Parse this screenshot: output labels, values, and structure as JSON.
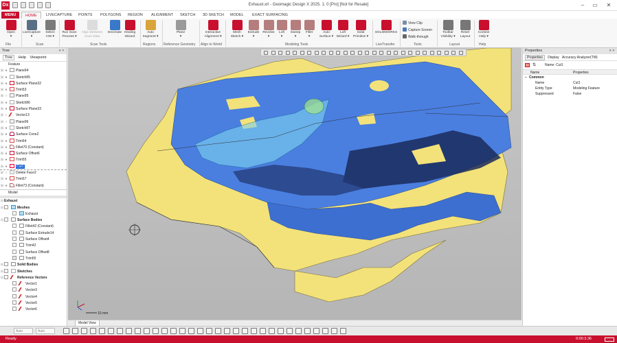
{
  "window": {
    "title": "Exhaust.xrl - Geomagic Design X 2025. 1. 0 [Pro] [Not for Resale]",
    "app_logo": "Dx",
    "controls": [
      "–",
      "▭",
      "✕"
    ]
  },
  "tabs": [
    "MENU",
    "HOME",
    "LIVECAPTURE",
    "POINTS",
    "POLYGONS",
    "REGION",
    "ALIGNMENT",
    "SKETCH",
    "3D SKETCH",
    "MODEL",
    "EXACT SURFACING"
  ],
  "ribbon": {
    "buttons": [
      {
        "label": "Open",
        "sub": "▾",
        "icon": "open-icon",
        "color": "#c8102e"
      },
      {
        "label": "LiveCapture",
        "sub": "▾",
        "icon": "livecapture-icon",
        "color": "#5a6f86"
      },
      {
        "label": "Select",
        "sub": "HW ▾",
        "icon": "select-hw-icon",
        "color": "#7a7a7a"
      },
      {
        "label": "Run Scan",
        "sub": "Process ▾",
        "icon": "run-scan-icon",
        "color": "#c8102e"
      },
      {
        "label": "Align Between",
        "sub": "Scan Data",
        "icon": "align-scan-icon",
        "color": "#bbbbbb",
        "disabled": true
      },
      {
        "label": "Decimate",
        "sub": "",
        "icon": "decimate-icon",
        "color": "#3a78c9"
      },
      {
        "label": "Healing",
        "sub": "Wizard",
        "icon": "healing-icon",
        "color": "#c8102e"
      },
      {
        "label": "Auto",
        "sub": "Segment ▾",
        "icon": "auto-segment-icon",
        "color": "#d9a43a"
      },
      {
        "label": "Plane",
        "sub": "▾",
        "icon": "plane-icon",
        "color": "#9a9a9a"
      },
      {
        "label": "Interactive",
        "sub": "Alignment ▾",
        "icon": "interactive-alignment-icon",
        "color": "#c8102e"
      },
      {
        "label": "Mesh",
        "sub": "Sketch ▾",
        "icon": "mesh-sketch-icon",
        "color": "#c8102e"
      },
      {
        "label": "Extrude",
        "sub": "▾",
        "icon": "extrude-icon",
        "color": "#b57d7d"
      },
      {
        "label": "Revolve",
        "sub": "▾",
        "icon": "revolve-icon",
        "color": "#b57d7d"
      },
      {
        "label": "Loft",
        "sub": "▾",
        "icon": "loft-icon",
        "color": "#b57d7d"
      },
      {
        "label": "Sweep",
        "sub": "▾",
        "icon": "sweep-icon",
        "color": "#b57d7d"
      },
      {
        "label": "Fillet",
        "sub": "▾",
        "icon": "fillet-icon",
        "color": "#b57d7d"
      },
      {
        "label": "Auto",
        "sub": "Surface ▾",
        "icon": "auto-surface-icon",
        "color": "#c8102e"
      },
      {
        "label": "Loft",
        "sub": "Wizard ▾",
        "icon": "loft-wizard-icon",
        "color": "#c8102e"
      },
      {
        "label": "Solid",
        "sub": "Primitive ▾",
        "icon": "solid-primitive-icon",
        "color": "#c8102e"
      },
      {
        "label": "SOLIDWORKS",
        "sub": "",
        "icon": "solidworks-icon",
        "color": "#c8102e"
      },
      {
        "label": "Toolbar",
        "sub": "Visibility ▾",
        "icon": "toolbar-visibility-icon",
        "color": "#777777"
      },
      {
        "label": "Reset",
        "sub": "Layout",
        "icon": "reset-layout-icon",
        "color": "#777777"
      },
      {
        "label": "Context",
        "sub": "Help ▾",
        "icon": "context-help-icon",
        "color": "#c8102e"
      }
    ],
    "small_buttons": [
      {
        "label": "View Clip",
        "color": "#7a8ea8"
      },
      {
        "label": "Capture Screen",
        "color": "#4a78b9"
      },
      {
        "label": "Walk-through",
        "color": "#666666"
      }
    ],
    "groups": [
      "File",
      "Scan",
      "Scan Tools",
      "Regions",
      "Reference Geometry",
      "Align to World",
      "Modeling Tools",
      "LiveTransfer",
      "Tools",
      "Layout",
      "Help"
    ]
  },
  "tree": {
    "title": "Tree",
    "tabs": [
      "Tree",
      "Help",
      "Viewpoint"
    ],
    "header": "Feature",
    "items": [
      {
        "label": "Plane94",
        "icon": "plane",
        "vis": "+"
      },
      {
        "label": "Sketch85",
        "icon": "sketch",
        "vis": "+"
      },
      {
        "label": "Surface Plane32",
        "icon": "surf",
        "vis": "+"
      },
      {
        "label": "Trim53",
        "icon": "trim",
        "vis": "+"
      },
      {
        "label": "Plane95",
        "icon": "plane",
        "vis": ""
      },
      {
        "label": "Sketch86",
        "icon": "sketch",
        "vis": "+"
      },
      {
        "label": "Surface Plane33",
        "icon": "surf",
        "vis": "+"
      },
      {
        "label": "Vector13",
        "icon": "vec",
        "vis": ""
      },
      {
        "label": "Plane96",
        "icon": "plane",
        "vis": ""
      },
      {
        "label": "Sketch87",
        "icon": "sketch",
        "vis": "+"
      },
      {
        "label": "Surface Cone2",
        "icon": "cone",
        "vis": "+"
      },
      {
        "label": "Trim54",
        "icon": "trim",
        "vis": "+"
      },
      {
        "label": "Fillet70 (Constant)",
        "icon": "fillet",
        "vis": "+"
      },
      {
        "label": "Surface Offset6",
        "icon": "surf",
        "vis": "+"
      },
      {
        "label": "Trim55",
        "icon": "trim",
        "vis": "+"
      },
      {
        "label": "Cut1",
        "icon": "cut",
        "vis": "+",
        "selected": true
      },
      {
        "label": "Delete Face2",
        "icon": "del",
        "vis": ""
      },
      {
        "label": "Trim57",
        "icon": "trim",
        "vis": "+"
      },
      {
        "label": "Fillet73 (Constant)",
        "icon": "fillet",
        "vis": "+"
      }
    ],
    "section_label": "Model"
  },
  "model_tree": {
    "root": "Exhaust",
    "items": [
      {
        "label": "Meshes",
        "bold": true,
        "indent": 1,
        "icon": "mesh"
      },
      {
        "label": "Exhaust",
        "indent": 2,
        "icon": "mesh"
      },
      {
        "label": "Surface Bodies",
        "bold": true,
        "indent": 1,
        "icon": "body"
      },
      {
        "label": "Fillet42 (Constant)",
        "indent": 2,
        "icon": "body"
      },
      {
        "label": "Surface Extrude14",
        "indent": 2,
        "icon": "body"
      },
      {
        "label": "Surface Offset4",
        "indent": 2,
        "icon": "body"
      },
      {
        "label": "Trim42",
        "indent": 2,
        "icon": "body"
      },
      {
        "label": "Surface Offset8",
        "indent": 2,
        "icon": "body"
      },
      {
        "label": "Trim55",
        "indent": 2,
        "icon": "body",
        "checked": true
      },
      {
        "label": "Solid Bodies",
        "bold": true,
        "indent": 1,
        "icon": "body"
      },
      {
        "label": "Sketches",
        "bold": true,
        "indent": 1,
        "icon": "sketch"
      },
      {
        "label": "Reference Vectors",
        "bold": true,
        "indent": 1,
        "icon": "vec"
      },
      {
        "label": "Vector1",
        "indent": 2,
        "icon": "vec"
      },
      {
        "label": "Vector3",
        "indent": 2,
        "icon": "vec"
      },
      {
        "label": "Vector4",
        "indent": 2,
        "icon": "vec"
      },
      {
        "label": "Vector5",
        "indent": 2,
        "icon": "vec"
      },
      {
        "label": "Vector6",
        "indent": 2,
        "icon": "vec"
      }
    ]
  },
  "viewport": {
    "scale_label": "10 mm",
    "tab": "Model View",
    "colors": {
      "yellow": "#f3e27a",
      "blue": "#4a7fe0",
      "cyan": "#7fd3ef",
      "bg": "#bdbdbd"
    }
  },
  "properties": {
    "title": "Properties",
    "tabs": [
      "Properties",
      "Display",
      "Accuracy Analyzer(TM)"
    ],
    "name_label": "Name: Cut1",
    "columns": [
      "Name",
      "Properties"
    ],
    "section": "Common",
    "rows": [
      {
        "k": "Name",
        "v": "Cut1"
      },
      {
        "k": "Entity Type",
        "v": "Modeling Feature"
      },
      {
        "k": "Suppressed",
        "v": "False"
      }
    ]
  },
  "bottom": {
    "selectors": [
      "Auto",
      "Auto"
    ],
    "status": "Ready",
    "time": "0:00:3.36"
  }
}
